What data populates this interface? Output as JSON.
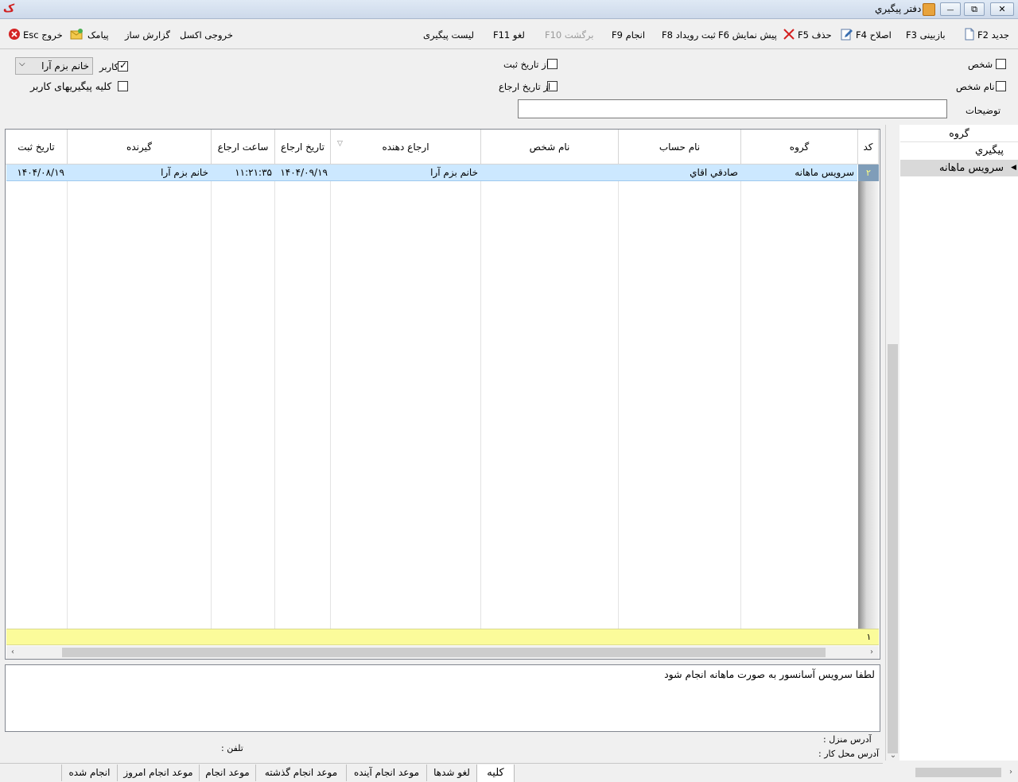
{
  "window": {
    "title": "دفتر پیگیري",
    "restore_glyph": "⧉",
    "minimize_glyph": "—",
    "close_glyph": "✕"
  },
  "toolbar": {
    "new": "جدید F2",
    "review": "بازبینی F3",
    "edit": "اصلاح F4",
    "delete": "حذف F5",
    "preview": "پیش نمایش F6",
    "register_event": "ثبت رویداد F8",
    "done": "انجام F9",
    "back": "برگشت F10",
    "cancel": "لغو F11",
    "list": "لیست پیگیری",
    "excel": "خروجی اکسل",
    "report": "گزارش ساز",
    "sms": "پیامک",
    "exit": "خروج Esc"
  },
  "filters": {
    "person_label": "شخص",
    "person_name_label": "نام شخص",
    "from_register_date_label": "از تاریخ ثبت",
    "from_refer_date_label": "از تاریخ ارجاع",
    "description_label": "توضیحات",
    "user_label": "کاربر",
    "user_value": "خانم بزم آرا",
    "all_user_followups_label": "کلیه پیگیریهای کاربر",
    "user_checked": true
  },
  "grid": {
    "headers": {
      "code": "کد",
      "group": "گروه",
      "account_name": "نام حساب",
      "person_name": "نام شخص",
      "referrer": "ارجاع دهنده",
      "refer_date": "تاریخ ارجاع",
      "refer_time": "ساعت ارجاع",
      "receiver": "گیرنده",
      "register_date": "تاریخ ثبت"
    },
    "rows": [
      {
        "code": "۲",
        "group": "سرویس ماهانه",
        "account_name": "صادقي اقاي",
        "person_name": "",
        "referrer": "خانم بزم آرا",
        "refer_date": "۱۴۰۴/۰۹/۱۹",
        "refer_time": "۱۱:۲۱:۳۵",
        "receiver": "خانم بزم آرا",
        "register_date": "۱۴۰۴/۰۸/۱۹"
      }
    ],
    "footer_count": "۱",
    "sort_glyph": "▽"
  },
  "comment": {
    "text": "لطفا سرویس آسانسور به صورت ماهانه انجام شود",
    "home_address_label": "آدرس منزل :",
    "work_address_label": "آدرس محل کار :",
    "phone_label": "تلفن :"
  },
  "group_panel": {
    "header": "گروه",
    "items": [
      "پیگیري",
      "سرويس ماهانه"
    ]
  },
  "tabs": [
    "کلیه",
    "لغو شدها",
    "موعد انجام آینده",
    "موعد انجام گذشته",
    "موعد انجام",
    "موعد انجام امروز",
    "انجام شده"
  ]
}
